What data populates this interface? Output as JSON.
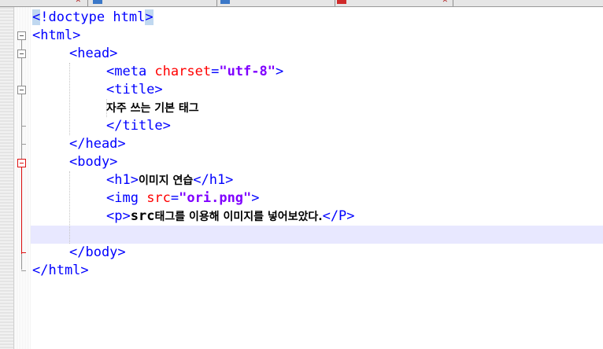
{
  "tabs": [
    {
      "icon": "blue",
      "label": ""
    },
    {
      "icon": "blue",
      "label": ""
    },
    {
      "icon": "red",
      "label": ""
    }
  ],
  "colors": {
    "tag": "#0000ff",
    "attribute": "#ff0000",
    "attribute_value": "#8000ff",
    "text": "#000000",
    "current_line": "#e8e8ff",
    "selection": "#c0d8f0",
    "fold_active": "#dd1111"
  },
  "code": {
    "l1": {
      "sel_open": "<",
      "doctype": "!doctype html",
      "sel_close": ">"
    },
    "l2": {
      "tag": "<html>"
    },
    "l3": {
      "tag": "<head>"
    },
    "l4": {
      "open": "<meta ",
      "attr": "charset",
      "eq": "=",
      "val": "\"utf-8\"",
      "close": ">"
    },
    "l5": {
      "tag": "<title>"
    },
    "l6": {
      "text": "자주 쓰는 기본 태그"
    },
    "l7": {
      "tag": "</title>"
    },
    "l8": {
      "tag": "</head>"
    },
    "l9": {
      "tag": "<body>"
    },
    "l10": {
      "open": "<h1>",
      "text": "이미지 연습",
      "close": "</h1>"
    },
    "l11": {
      "open": "<img ",
      "attr": "src",
      "eq": "=",
      "val": "\"ori.png\"",
      "close": ">"
    },
    "l12": {
      "open": "<p>",
      "bold": "src",
      "text": "태그를 이용해 이미지를 넣어보았다.",
      "close": "</P>"
    },
    "l13": {
      "text": ""
    },
    "l14": {
      "tag": "</body>"
    },
    "l15": {
      "tag": "</html>"
    }
  }
}
